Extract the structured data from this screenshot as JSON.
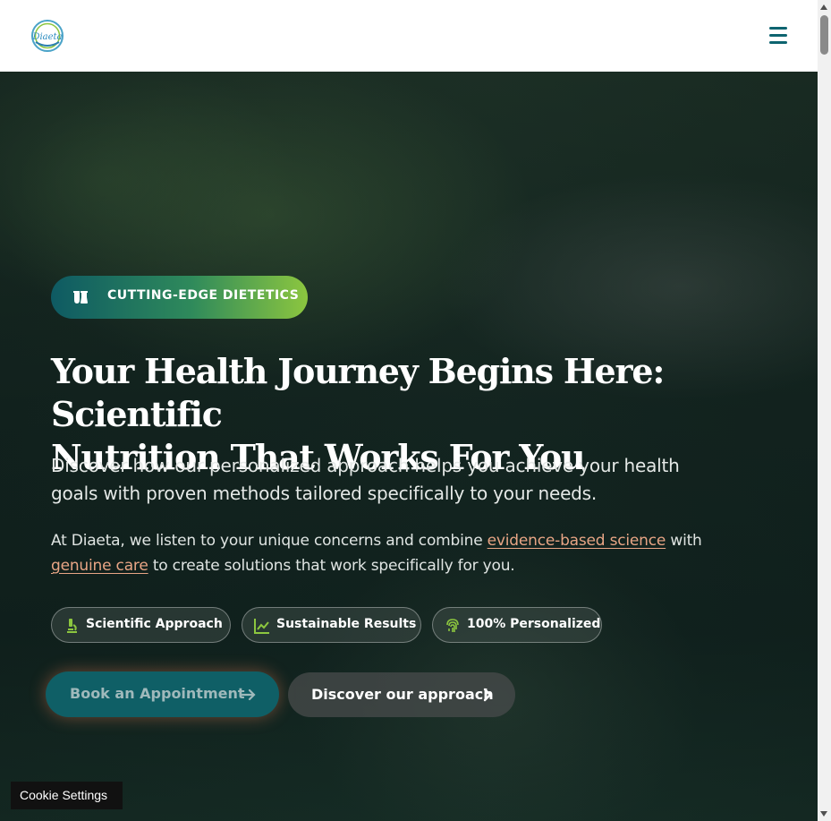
{
  "header": {
    "logo_text": "Diaeta",
    "menu_icon": "hamburger-menu-icon",
    "brand_color": "#0e6470"
  },
  "hero": {
    "badge": {
      "icon": "flask-icon",
      "label": "CUTTING-EDGE DIETETICS"
    },
    "headline_line1": "Your Health Journey Begins Here: Scientific",
    "headline_line2": "Nutrition That Works For You",
    "subhead_line1": "Discover how our personalized approach helps you achieve your health",
    "subhead_line2": "goals with proven methods tailored specifically to your needs.",
    "body": {
      "prefix": "At Diaeta, we listen to your unique concerns and combine ",
      "link1": "evidence-based science",
      "middle": " with ",
      "link2": "genuine care",
      "suffix": " to create solutions that work specifically for you."
    },
    "features": [
      {
        "icon": "microscope-icon",
        "label": "Scientific Approach"
      },
      {
        "icon": "chart-line-icon",
        "label": "Sustainable Results"
      },
      {
        "icon": "fingerprint-icon",
        "label": "100% Personalized"
      }
    ],
    "primary_button": {
      "label": "Book an Appointment",
      "icon": "arrow-right-icon"
    },
    "secondary_button": {
      "label": "Discover our approach",
      "icon": "chevron-right-icon"
    }
  },
  "cookie": {
    "label": "Cookie Settings"
  },
  "colors": {
    "accent_green": "#8cc63f",
    "teal": "#0e6470",
    "link_orange": "#e8a585"
  }
}
